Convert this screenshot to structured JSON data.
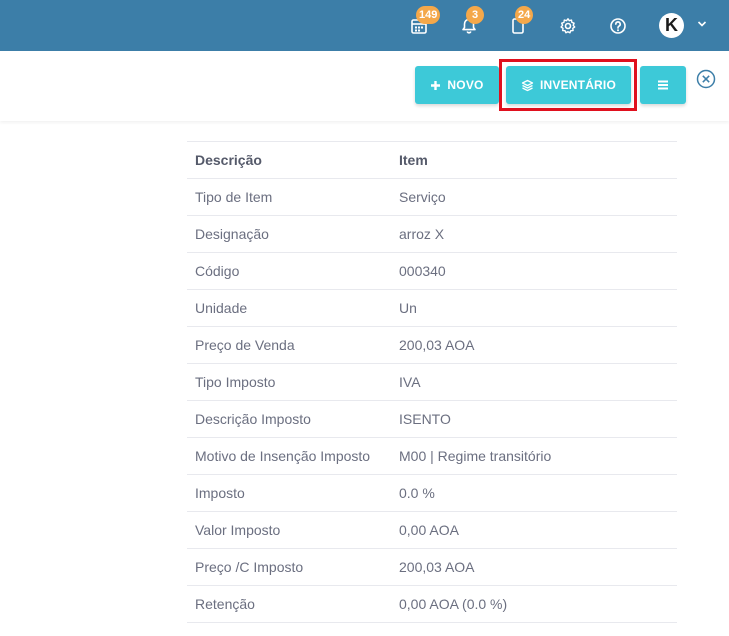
{
  "topbar": {
    "colors": {
      "bar": "#3c7ea8",
      "badge": "#f4a84a"
    },
    "items": [
      {
        "icon": "calendar-icon",
        "badge": "149"
      },
      {
        "icon": "bell-icon",
        "badge": "3"
      },
      {
        "icon": "document-icon",
        "badge": "24"
      },
      {
        "icon": "gear-icon"
      },
      {
        "icon": "help-icon"
      }
    ],
    "avatar_letter": "K"
  },
  "toolbar": {
    "novo_label": "NOVO",
    "inventario_label": "INVENTÁRIO",
    "accent": "#3dc9d8",
    "highlight_color": "#e0101e"
  },
  "table": {
    "header": {
      "key": "Descrição",
      "value": "Item"
    },
    "rows": [
      {
        "key": "Tipo de Item",
        "value": "Serviço"
      },
      {
        "key": "Designação",
        "value": "arroz X"
      },
      {
        "key": "Código",
        "value": "000340"
      },
      {
        "key": "Unidade",
        "value": "Un"
      },
      {
        "key": "Preço de Venda",
        "value": "200,03 AOA"
      },
      {
        "key": "Tipo Imposto",
        "value": "IVA"
      },
      {
        "key": "Descrição Imposto",
        "value": "ISENTO"
      },
      {
        "key": "Motivo de Insenção Imposto",
        "value": "M00 | Regime transitório"
      },
      {
        "key": "Imposto",
        "value": "0.0 %"
      },
      {
        "key": "Valor Imposto",
        "value": "0,00 AOA"
      },
      {
        "key": "Preço /C Imposto",
        "value": "200,03 AOA"
      },
      {
        "key": "Retenção",
        "value": "0,00 AOA (0.0 %)"
      }
    ]
  }
}
